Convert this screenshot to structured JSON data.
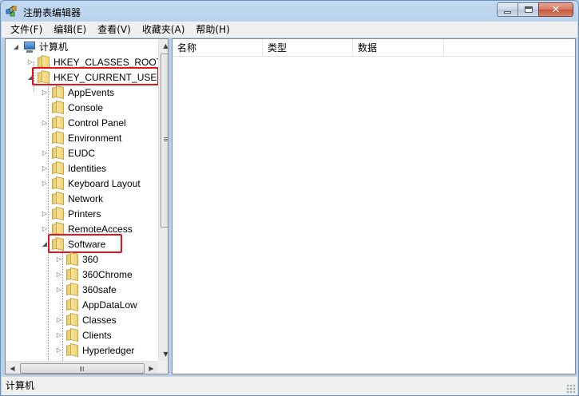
{
  "window": {
    "title": "注册表编辑器"
  },
  "menu": [
    "文件(F)",
    "编辑(E)",
    "查看(V)",
    "收藏夹(A)",
    "帮助(H)"
  ],
  "tree": {
    "root_label": "计算机",
    "hkcr": "HKEY_CLASSES_ROOT",
    "hkcu": "HKEY_CURRENT_USER",
    "hkcu_children": [
      "AppEvents",
      "Console",
      "Control Panel",
      "Environment",
      "EUDC",
      "Identities",
      "Keyboard Layout",
      "Network",
      "Printers",
      "RemoteAccess",
      "Software"
    ],
    "software_children": [
      "360",
      "360Chrome",
      "360safe",
      "AppDataLow",
      "Classes",
      "Clients",
      "Hyperledger"
    ]
  },
  "list": {
    "columns": [
      "名称",
      "类型",
      "数据"
    ]
  },
  "statusbar": {
    "path": "计算机"
  },
  "colors": {
    "highlight": "#e3151c",
    "title_bg": "#c2d9f1"
  }
}
